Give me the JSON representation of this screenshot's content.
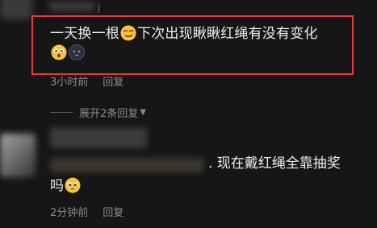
{
  "comment1": {
    "text_a": "一天换一根",
    "text_b": "下次出现瞅瞅红绳有没有变化",
    "time": "3小时前",
    "reply": "回复"
  },
  "thread": {
    "expand_label": "展开2条回复",
    "expand_icon": "triangle-down-icon"
  },
  "comment2": {
    "text_line1": ". 现在戴红绳全靠抽奖",
    "text_line2": "吗",
    "time": "2分钟前",
    "reply": "回复"
  },
  "emojis": [
    "smirk-emoji",
    "astonished-emoji",
    "dark-face-emoji",
    "pleading-emoji"
  ],
  "highlight_color": "#e53935"
}
